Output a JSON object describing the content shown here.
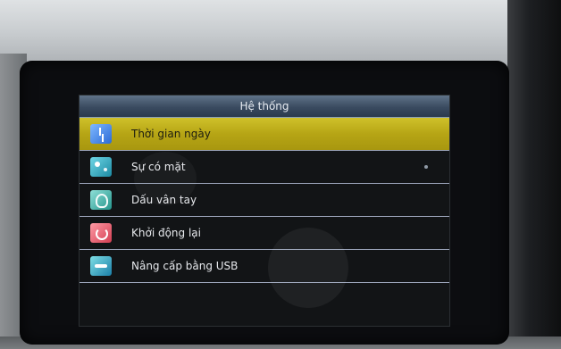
{
  "screen": {
    "title": "Hệ thống",
    "menu": [
      {
        "label": "Thời gian ngày",
        "icon": "clock-icon",
        "selected": true
      },
      {
        "label": "Sự có mặt",
        "icon": "attendance-icon",
        "selected": false
      },
      {
        "label": "Dấu vân tay",
        "icon": "fingerprint-icon",
        "selected": false
      },
      {
        "label": "Khởi động lại",
        "icon": "restart-icon",
        "selected": false
      },
      {
        "label": "Nâng cấp bằng USB",
        "icon": "usb-upgrade-icon",
        "selected": false
      }
    ]
  },
  "colors": {
    "selected_row": "#b6a515",
    "title_bar": "#3a4b60",
    "separator": "#9aa3b8",
    "background": "#121416"
  }
}
